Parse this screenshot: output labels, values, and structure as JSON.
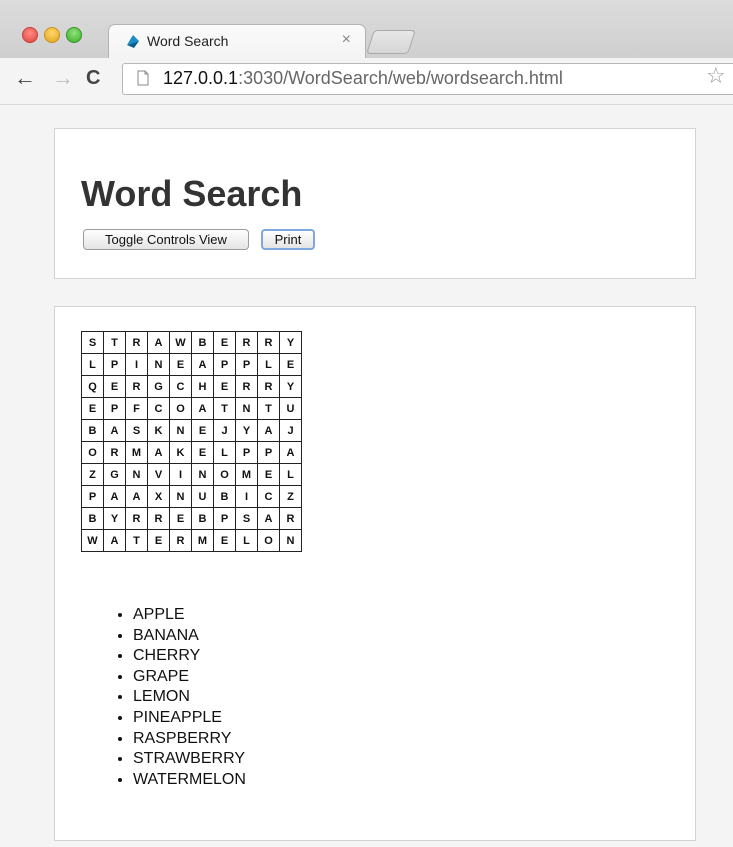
{
  "browser": {
    "tab_title": "Word Search",
    "tab_close": "×",
    "url_host": "127.0.0.1",
    "url_rest": ":3030/WordSearch/web/wordsearch.html",
    "icons": [
      "back-arrow-icon",
      "forward-arrow-icon",
      "reload-icon",
      "page-icon",
      "bookmark-star-icon"
    ]
  },
  "header": {
    "title": "Word Search",
    "toggle_label": "Toggle Controls View",
    "print_label": "Print"
  },
  "grid": {
    "rows": [
      [
        "S",
        "T",
        "R",
        "A",
        "W",
        "B",
        "E",
        "R",
        "R",
        "Y"
      ],
      [
        "L",
        "P",
        "I",
        "N",
        "E",
        "A",
        "P",
        "P",
        "L",
        "E"
      ],
      [
        "Q",
        "E",
        "R",
        "G",
        "C",
        "H",
        "E",
        "R",
        "R",
        "Y"
      ],
      [
        "E",
        "P",
        "F",
        "C",
        "O",
        "A",
        "T",
        "N",
        "T",
        "U"
      ],
      [
        "B",
        "A",
        "S",
        "K",
        "N",
        "E",
        "J",
        "Y",
        "A",
        "J"
      ],
      [
        "O",
        "R",
        "M",
        "A",
        "K",
        "E",
        "L",
        "P",
        "P",
        "A"
      ],
      [
        "Z",
        "G",
        "N",
        "V",
        "I",
        "N",
        "O",
        "M",
        "E",
        "L"
      ],
      [
        "P",
        "A",
        "A",
        "X",
        "N",
        "U",
        "B",
        "I",
        "C",
        "Z"
      ],
      [
        "B",
        "Y",
        "R",
        "R",
        "E",
        "B",
        "P",
        "S",
        "A",
        "R"
      ],
      [
        "W",
        "A",
        "T",
        "E",
        "R",
        "M",
        "E",
        "L",
        "O",
        "N"
      ]
    ]
  },
  "words": [
    "APPLE",
    "BANANA",
    "CHERRY",
    "GRAPE",
    "LEMON",
    "PINEAPPLE",
    "RASPBERRY",
    "STRAWBERRY",
    "WATERMELON"
  ]
}
